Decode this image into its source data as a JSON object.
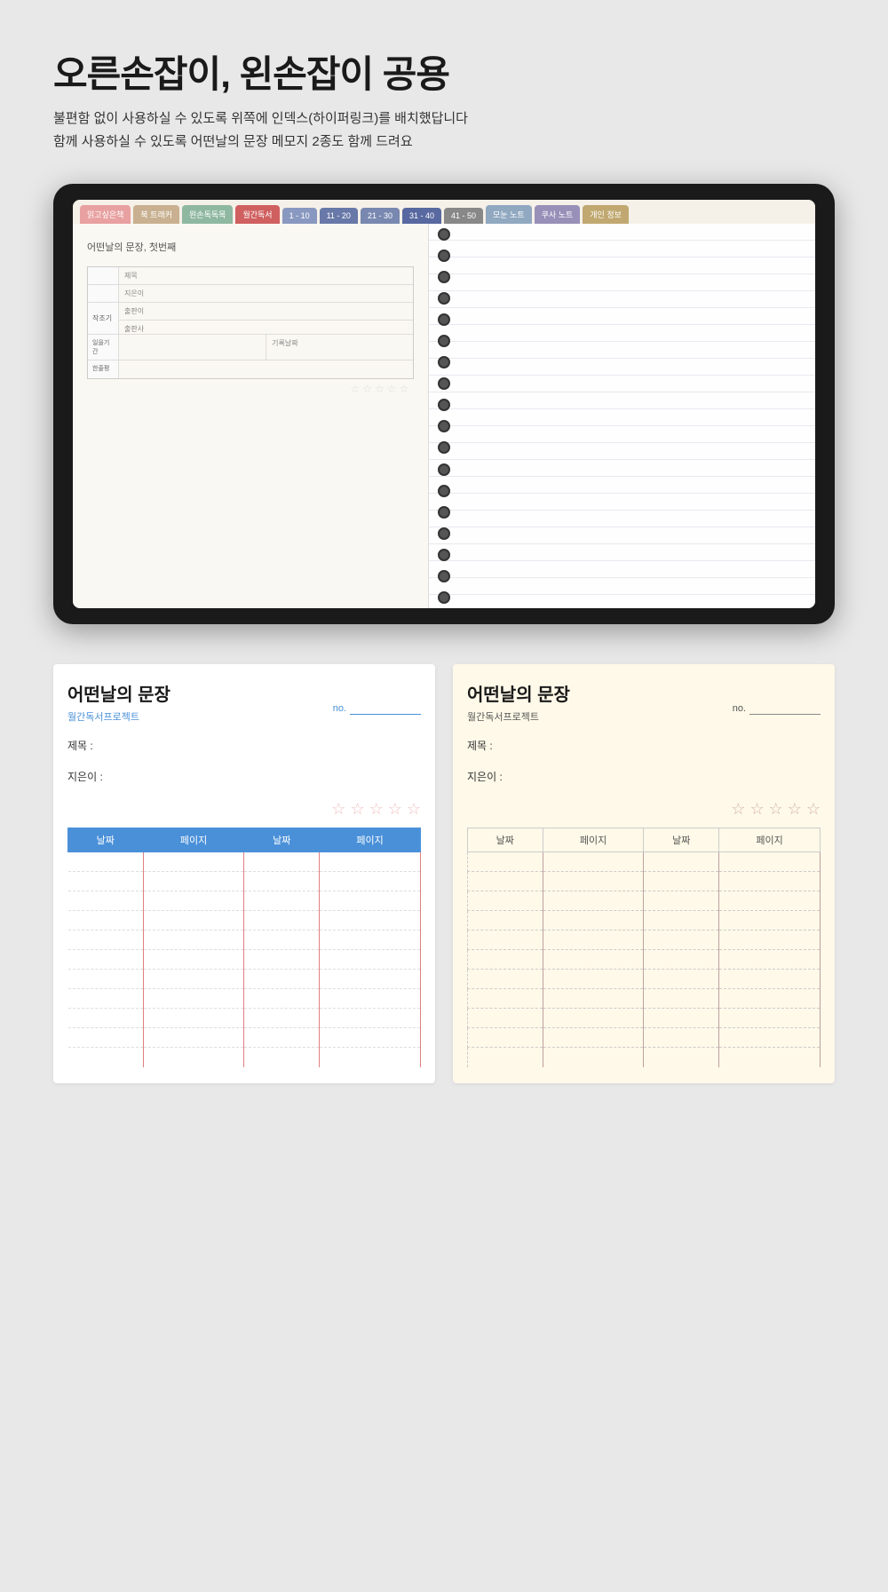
{
  "page": {
    "title": "오른손잡이, 왼손잡이 공용",
    "subtitle_line1": "불편함 없이 사용하실 수 있도록 위쪽에 인덱스(하이퍼링크)를 배치했답니다",
    "subtitle_line2": "함께 사용하실 수 있도록 어떤날의 문장 메모지 2종도 함께 드려요"
  },
  "tabs": [
    {
      "label": "읽고싶은책",
      "color": "pink"
    },
    {
      "label": "북 트래커",
      "color": "beige"
    },
    {
      "label": "왼손독독목",
      "color": "green"
    },
    {
      "label": "월간독서",
      "color": "red"
    },
    {
      "label": "1 - 10",
      "color": "blue1"
    },
    {
      "label": "11 - 20",
      "color": "blue2"
    },
    {
      "label": "21 - 30",
      "color": "blue3"
    },
    {
      "label": "31 - 40",
      "color": "blue4"
    },
    {
      "label": "41 - 50",
      "color": "gray"
    },
    {
      "label": "모눈 노트",
      "color": "light-blue"
    },
    {
      "label": "쿠사 노트",
      "color": "lavender"
    },
    {
      "label": "개인 정보",
      "color": "tan"
    }
  ],
  "left_page": {
    "title": "어떤날의 문장, 첫번째",
    "form_fields": [
      {
        "label": "",
        "value": "제목"
      },
      {
        "label": "",
        "value": "지은이"
      },
      {
        "label": "작조기",
        "value": "출판이"
      },
      {
        "label": "",
        "value": "출판사"
      },
      {
        "label": "일을기간",
        "value": "기록날짜"
      },
      {
        "label": "한줄평",
        "value": ""
      }
    ]
  },
  "card_white": {
    "title": "어떤날의 문장",
    "subtitle": "월간독서프로젝트",
    "no_label": "no.",
    "field1_label": "제목 :",
    "field2_label": "지은이 :",
    "table_headers": [
      "날짜",
      "페이지",
      "날짜",
      "페이지"
    ],
    "rows": 11
  },
  "card_cream": {
    "title": "어떤날의 문장",
    "subtitle": "월간독서프로젝트",
    "no_label": "no.",
    "field1_label": "제목 :",
    "field2_label": "지은이 :",
    "table_headers": [
      "날짜",
      "페이지",
      "날짜",
      "페이지"
    ],
    "rows": 11
  },
  "stars": [
    "☆",
    "☆",
    "☆",
    "☆",
    "☆"
  ]
}
